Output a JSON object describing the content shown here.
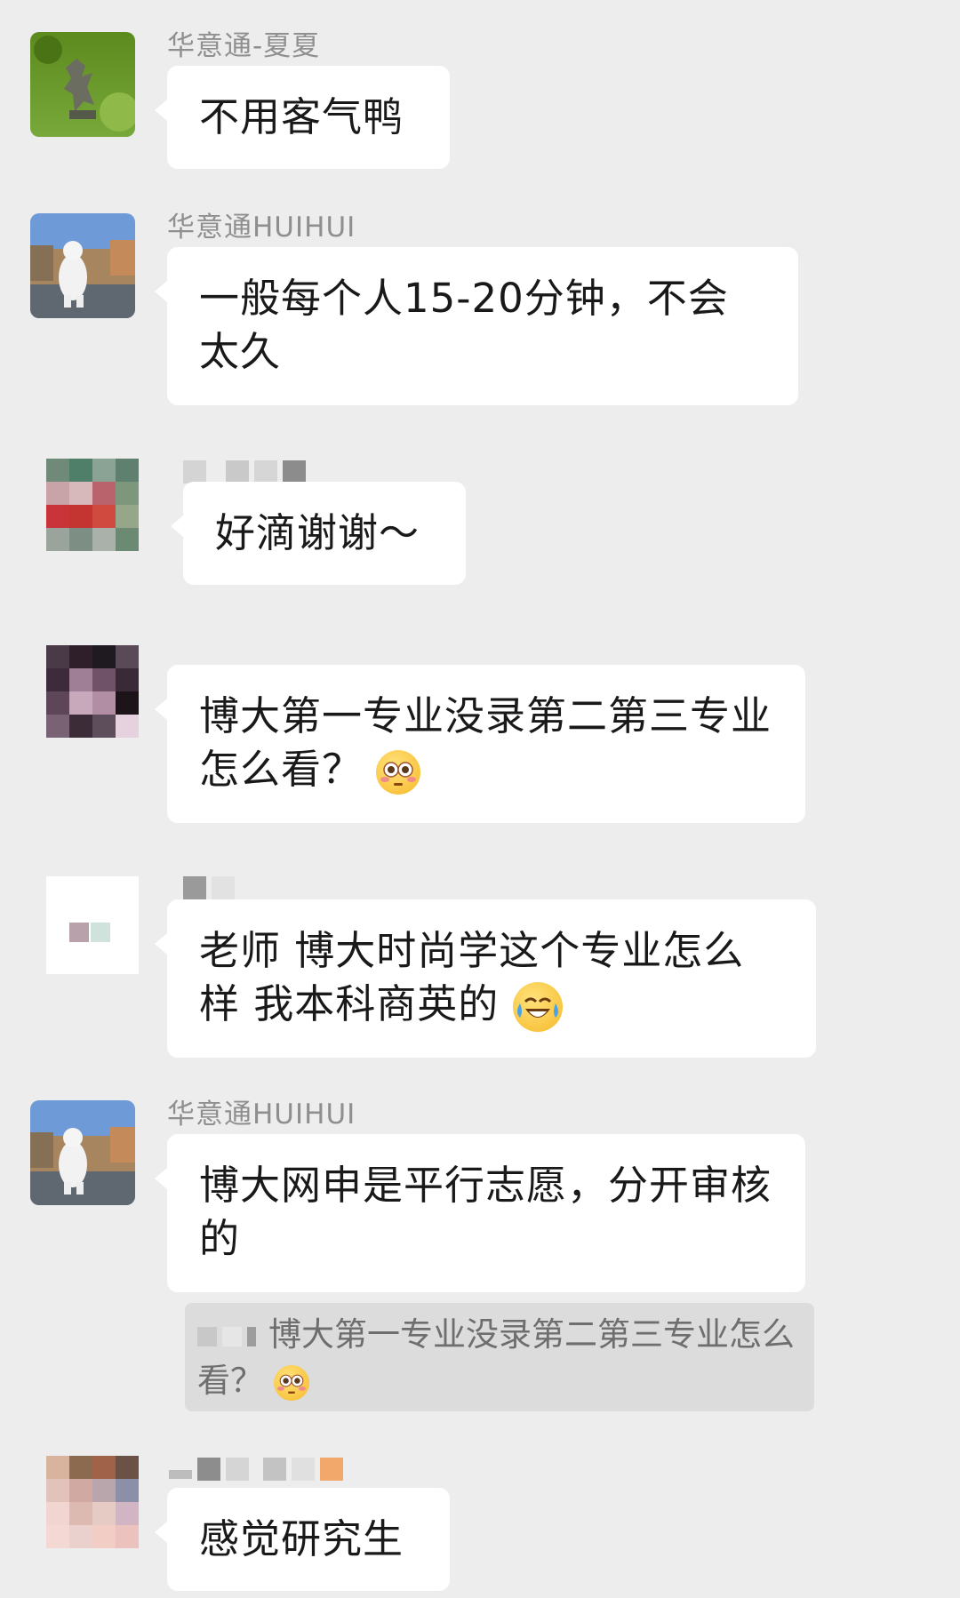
{
  "messages": [
    {
      "sender": "华意通-夏夏",
      "text": "不用客气鸭"
    },
    {
      "sender": "华意通HUIHUI",
      "text": "一般每个人15-20分钟，不会太久"
    },
    {
      "sender": "",
      "text": "好滴谢谢～"
    },
    {
      "sender": "",
      "text": "博大第一专业没录第二第三专业怎么看？"
    },
    {
      "sender": "",
      "text": "老师 博大时尚学这个专业怎么样 我本科商英的"
    },
    {
      "sender": "华意通HUIHUI",
      "text": "博大网申是平行志愿，分开审核的",
      "quote": "博大第一专业没录第二第三专业怎么看？"
    },
    {
      "sender": "",
      "text": "感觉研究生"
    }
  ],
  "icons": {
    "flushed": "flushed-face-emoji",
    "laughing_crying": "rolling-on-floor-laughing-emoji"
  }
}
